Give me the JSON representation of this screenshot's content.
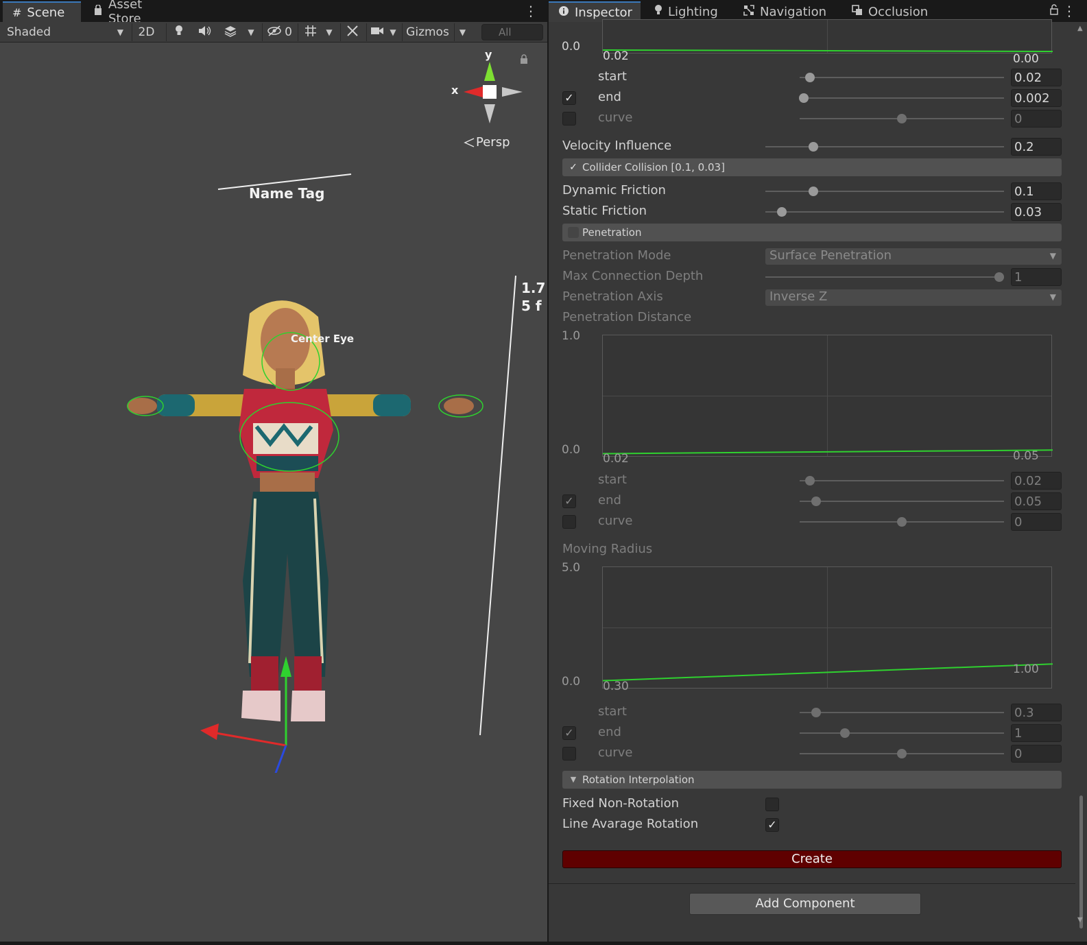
{
  "scene_tabs": [
    {
      "label": "Scene",
      "icon": "hash-icon"
    },
    {
      "label": "Asset Store",
      "icon": "shopping-bag-icon"
    }
  ],
  "scene_toolbar": {
    "shading_mode": "Shaded",
    "mode_2d": "2D",
    "hidden_count": "0",
    "gizmos_label": "Gizmos",
    "search_placeholder": "All"
  },
  "viewport": {
    "axis_y": "y",
    "axis_x": "x",
    "projection": "Persp",
    "name_tag": "Name Tag",
    "center_eye": "Center Eye",
    "height_line1": "1.7",
    "height_line2": "5 f"
  },
  "inspector_tabs": [
    {
      "label": "Inspector",
      "icon": "info-icon"
    },
    {
      "label": "Lighting",
      "icon": "lightbulb-icon"
    },
    {
      "label": "Navigation",
      "icon": "navigation-icon"
    },
    {
      "label": "Occlusion",
      "icon": "occlusion-icon"
    }
  ],
  "colors": {
    "create_button": "#5f0000",
    "curve_line": "#2fd12f",
    "accent_tab": "#3a79bb"
  },
  "inspector": {
    "top_graph": {
      "y_min": "0.0",
      "left_value": "0.02",
      "right_value": "0.00"
    },
    "top_start": {
      "label": "start",
      "value": "0.02",
      "fraction": 0.05
    },
    "top_end": {
      "label": "end",
      "value": "0.002",
      "fraction": 0.02,
      "checked": true
    },
    "top_curve": {
      "label": "curve",
      "value": "0",
      "fraction": 0.5,
      "checked": false
    },
    "velocity_influence": {
      "label": "Velocity Influence",
      "value": "0.2",
      "fraction": 0.2
    },
    "collider_collision": {
      "label": "Collider Collision [0.1, 0.03]",
      "checked": true
    },
    "dynamic_friction": {
      "label": "Dynamic Friction",
      "value": "0.1",
      "fraction": 0.2
    },
    "static_friction": {
      "label": "Static Friction",
      "value": "0.03",
      "fraction": 0.07
    },
    "penetration": {
      "label": "Penetration",
      "checked": false
    },
    "penetration_mode": {
      "label": "Penetration Mode",
      "value": "Surface Penetration"
    },
    "max_connection_depth": {
      "label": "Max Connection Depth",
      "value": "1",
      "fraction": 0.98
    },
    "penetration_axis": {
      "label": "Penetration Axis",
      "value": "Inverse Z"
    },
    "penetration_distance": {
      "label": "Penetration Distance",
      "y_max": "1.0",
      "y_min": "0.0",
      "left_value": "0.02",
      "right_value": "0.05",
      "start": {
        "label": "start",
        "value": "0.02",
        "fraction": 0.05
      },
      "end": {
        "label": "end",
        "value": "0.05",
        "fraction": 0.08,
        "checked": true
      },
      "curve": {
        "label": "curve",
        "value": "0",
        "fraction": 0.5,
        "checked": false
      }
    },
    "moving_radius": {
      "label": "Moving Radius",
      "y_max": "5.0",
      "y_min": "0.0",
      "left_value": "0.30",
      "right_value": "1.00",
      "start": {
        "label": "start",
        "value": "0.3",
        "fraction": 0.08
      },
      "end": {
        "label": "end",
        "value": "1",
        "fraction": 0.22,
        "checked": true
      },
      "curve": {
        "label": "curve",
        "value": "0",
        "fraction": 0.5,
        "checked": false
      }
    },
    "rotation_interpolation": {
      "label": "Rotation Interpolation",
      "expanded": true
    },
    "fixed_non_rotation": {
      "label": "Fixed Non-Rotation",
      "checked": false
    },
    "line_average_rotation": {
      "label": "Line Avarage Rotation",
      "checked": true
    },
    "create_label": "Create",
    "add_component_label": "Add Component"
  }
}
